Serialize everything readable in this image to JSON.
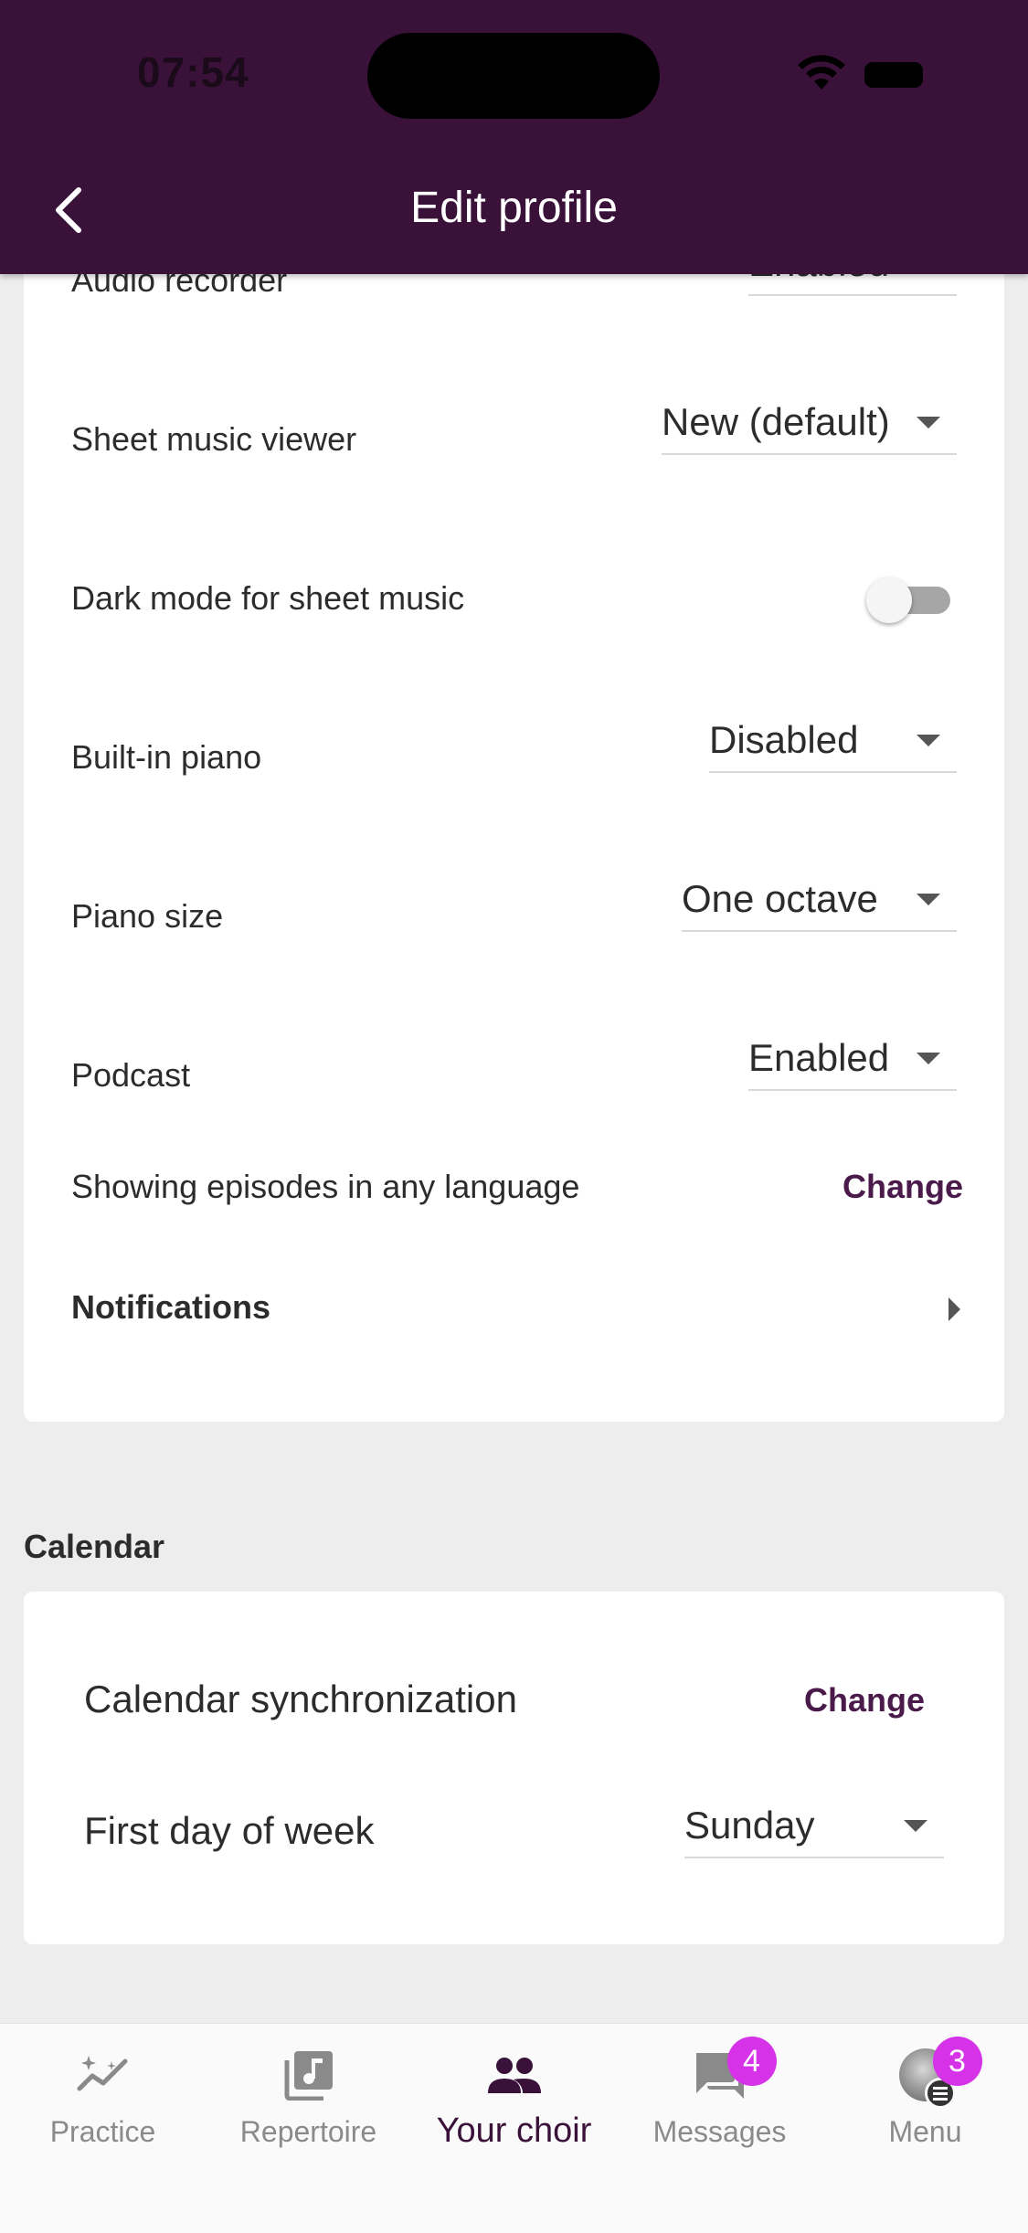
{
  "status_bar": {
    "time": "07:54"
  },
  "header": {
    "title": "Edit profile",
    "back_icon": "chevron-left-icon"
  },
  "settings": {
    "audio_recorder": {
      "label": "Audio recorder",
      "value": "Enabled"
    },
    "sheet_music_viewer": {
      "label": "Sheet music viewer",
      "value": "New (default)"
    },
    "dark_mode": {
      "label": "Dark mode for sheet music",
      "enabled": false
    },
    "built_in_piano": {
      "label": "Built-in piano",
      "value": "Disabled"
    },
    "piano_size": {
      "label": "Piano size",
      "value": "One octave"
    },
    "podcast": {
      "label": "Podcast",
      "value": "Enabled"
    },
    "episodes_language": {
      "label": "Showing episodes in any language",
      "action": "Change"
    },
    "notifications": {
      "label": "Notifications"
    }
  },
  "calendar": {
    "heading": "Calendar",
    "sync": {
      "label": "Calendar synchronization",
      "action": "Change"
    },
    "first_day": {
      "label": "First day of week",
      "value": "Sunday"
    }
  },
  "bottom_nav": {
    "items": [
      {
        "label": "Practice",
        "icon": "trending-icon"
      },
      {
        "label": "Repertoire",
        "icon": "music-note-icon"
      },
      {
        "label": "Your choir",
        "icon": "group-icon",
        "active": true
      },
      {
        "label": "Messages",
        "icon": "chat-icon",
        "badge": "4"
      },
      {
        "label": "Menu",
        "icon": "avatar-icon",
        "badge": "3"
      }
    ]
  },
  "colors": {
    "header_bg": "#3a1139",
    "accent": "#4a1a4a",
    "badge": "#d633e8",
    "background": "#eeeded"
  }
}
